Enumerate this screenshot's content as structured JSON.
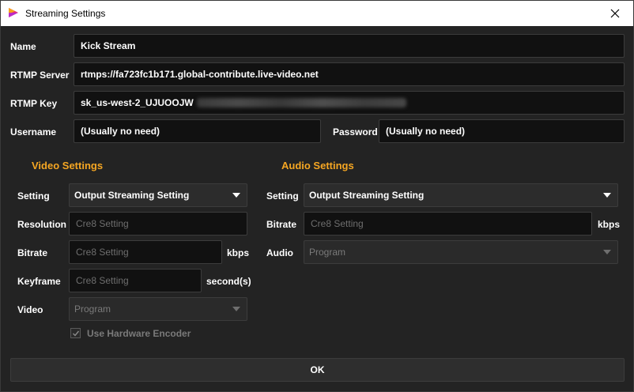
{
  "window": {
    "title": "Streaming Settings",
    "close_glyph": "×"
  },
  "stream": {
    "name_label": "Name",
    "name_value": "Kick Stream",
    "server_label": "RTMP Server",
    "server_value": "rtmps://fa723fc1b171.global-contribute.live-video.net",
    "key_label": "RTMP Key",
    "key_value": "sk_us-west-2_UJUOOJW",
    "username_label": "Username",
    "username_value": "(Usually no need)",
    "password_label": "Password",
    "password_value": "(Usually no need)"
  },
  "video": {
    "section_title": "Video Settings",
    "setting_label": "Setting",
    "setting_value": "Output Streaming Setting",
    "resolution_label": "Resolution",
    "resolution_placeholder": "Cre8 Setting",
    "bitrate_label": "Bitrate",
    "bitrate_placeholder": "Cre8 Setting",
    "bitrate_unit": "kbps",
    "keyframe_label": "Keyframe",
    "keyframe_placeholder": "Cre8 Setting",
    "keyframe_unit": "second(s)",
    "video_label": "Video",
    "video_value": "Program",
    "hw_encoder_label": "Use Hardware Encoder",
    "hw_encoder_checked": true
  },
  "audio": {
    "section_title": "Audio Settings",
    "setting_label": "Setting",
    "setting_value": "Output Streaming Setting",
    "bitrate_label": "Bitrate",
    "bitrate_placeholder": "Cre8 Setting",
    "bitrate_unit": "kbps",
    "audio_label": "Audio",
    "audio_value": "Program"
  },
  "actions": {
    "ok_label": "OK"
  },
  "colors": {
    "accent": "#f5a623",
    "background": "#232323",
    "field_bg": "#111111"
  },
  "icons": {
    "app": "app-logo-icon",
    "close": "close-icon",
    "dropdown": "chevron-down-icon",
    "check": "checkmark-icon"
  }
}
